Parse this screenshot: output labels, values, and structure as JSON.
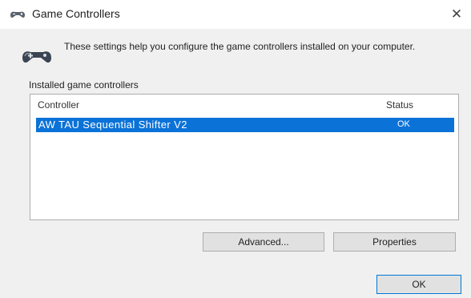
{
  "window": {
    "title": "Game Controllers",
    "close_glyph": "✕",
    "title_icon": "gamepad-icon"
  },
  "header": {
    "icon": "gamepad-icon",
    "description": "These settings help you configure the game controllers installed on your computer."
  },
  "installed": {
    "group_label": "Installed game controllers",
    "columns": {
      "controller": "Controller",
      "status": "Status"
    },
    "rows": [
      {
        "name": "AW TAU Sequential Shifter V2",
        "status": "OK",
        "selected": true
      }
    ]
  },
  "buttons": {
    "advanced": "Advanced...",
    "properties": "Properties",
    "ok": "OK"
  },
  "colors": {
    "selection": "#0b72d8",
    "window_bg": "#f0f0f0",
    "titlebar_bg": "#ffffff"
  }
}
